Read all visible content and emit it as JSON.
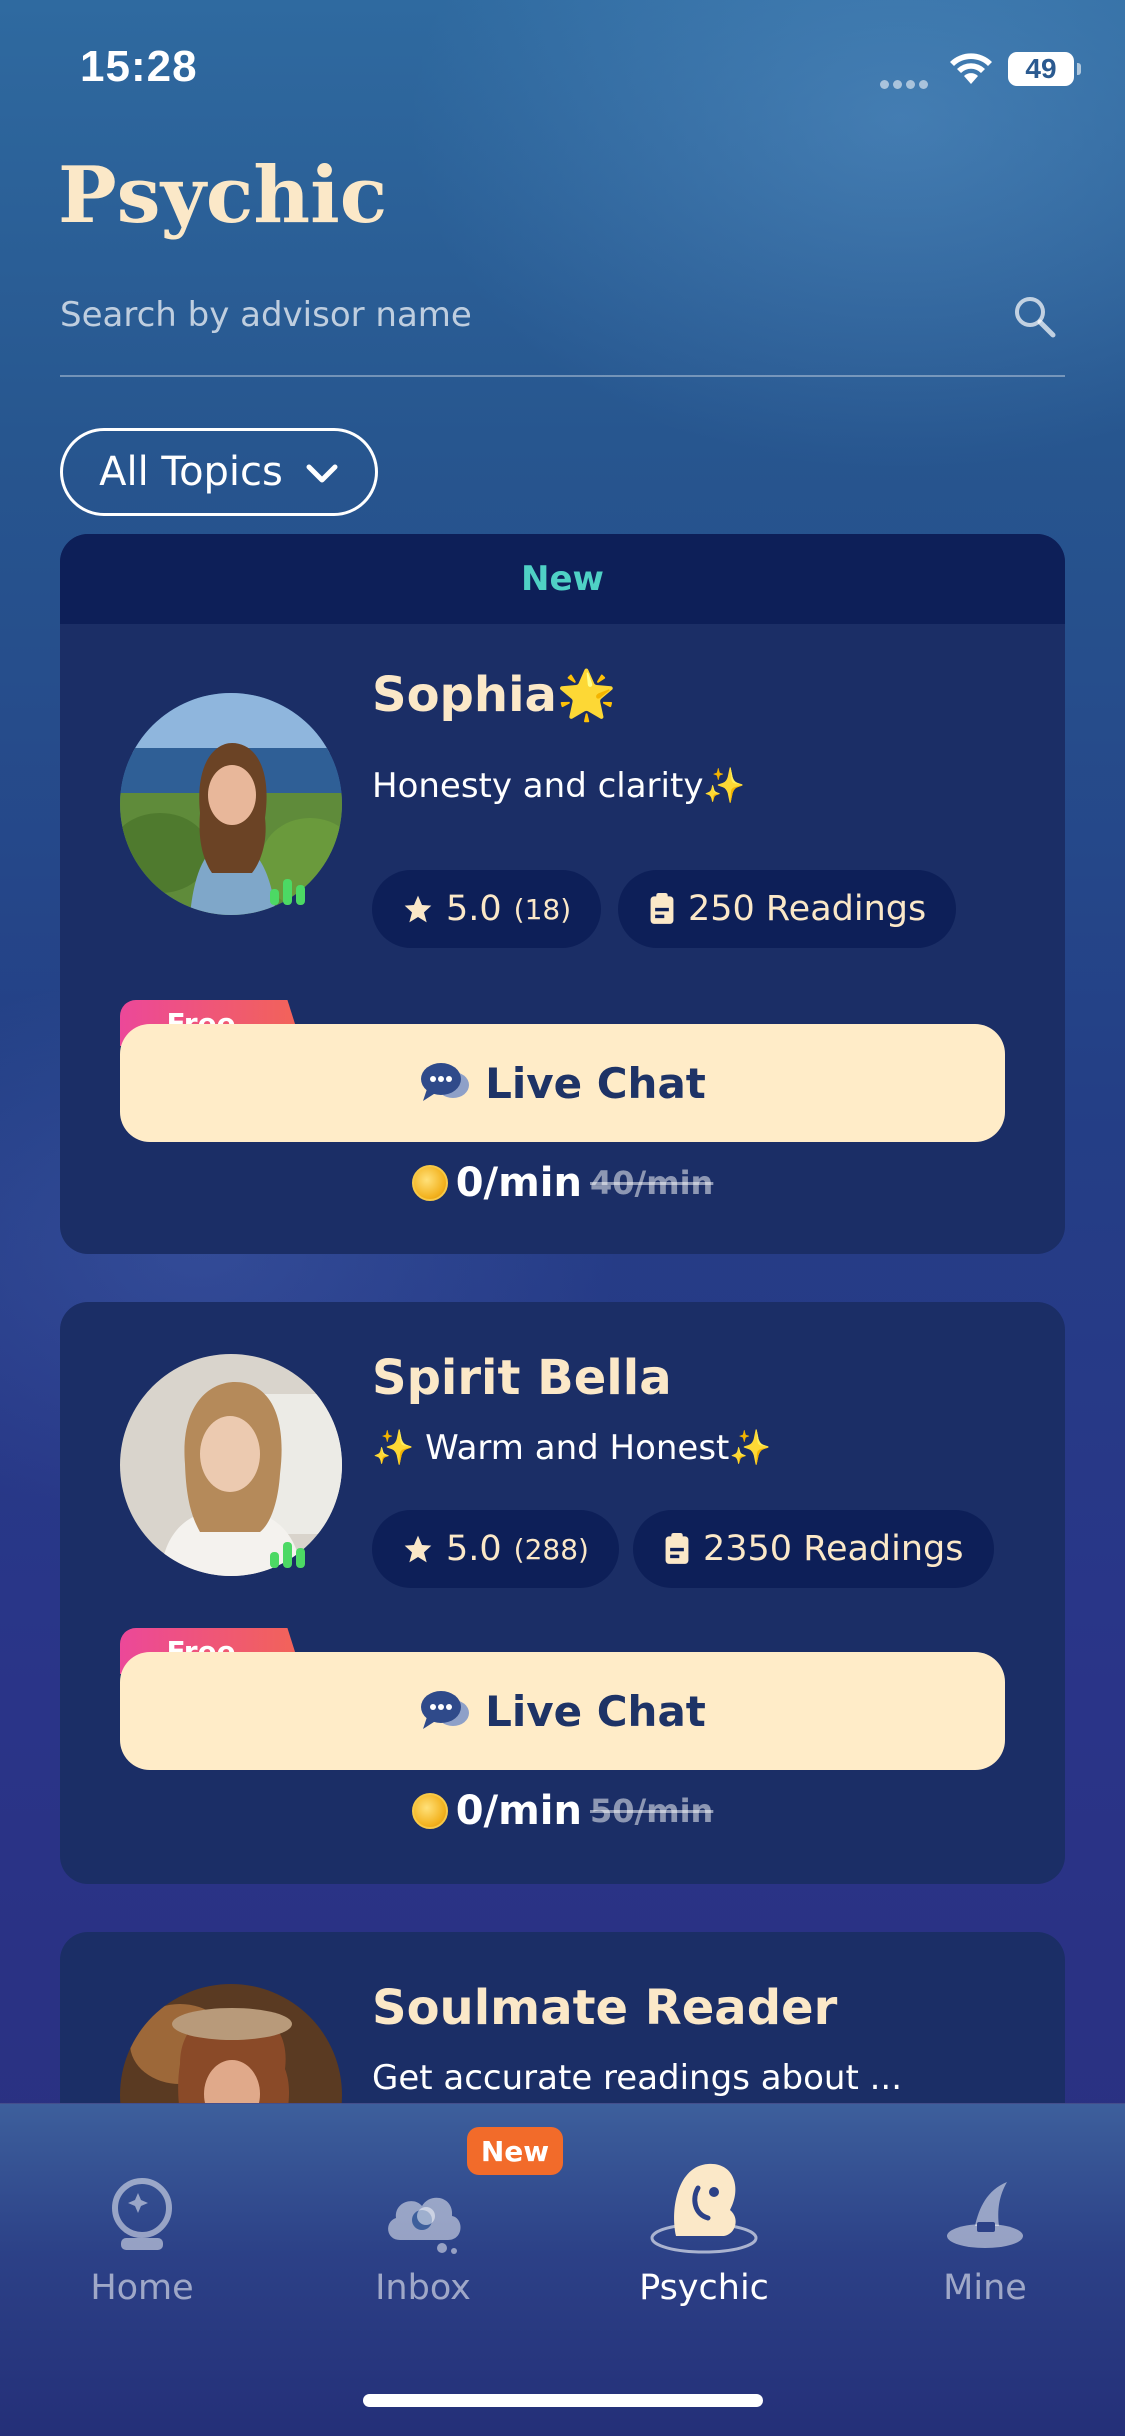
{
  "status_bar": {
    "time": "15:28",
    "battery": "49"
  },
  "page": {
    "title": "Psychic"
  },
  "search": {
    "placeholder": "Search by advisor name"
  },
  "filter": {
    "label": "All Topics"
  },
  "advisors": [
    {
      "banner": "New",
      "name": "Sophia🌟",
      "tagline": "Honesty and clarity✨",
      "rating": "5.0",
      "rating_count": "(18)",
      "readings": "250 Readings",
      "free_tag": "Free",
      "chat_label": "Live Chat",
      "price_now": "0/min",
      "price_old": "40/min"
    },
    {
      "name": "Spirit Bella",
      "tagline": "✨ Warm and Honest✨",
      "rating": "5.0",
      "rating_count": "(288)",
      "readings": "2350 Readings",
      "free_tag": "Free",
      "chat_label": "Live Chat",
      "price_now": "0/min",
      "price_old": "50/min"
    },
    {
      "name": "Soulmate Reader",
      "tagline": "Get accurate readings about ..."
    }
  ],
  "tab_bar": {
    "items": [
      {
        "label": "Home",
        "icon": "crystal-ball-icon"
      },
      {
        "label": "Inbox",
        "icon": "cloud-moon-icon",
        "badge": "New"
      },
      {
        "label": "Psychic",
        "icon": "psychic-icon",
        "active": true
      },
      {
        "label": "Mine",
        "icon": "witch-hat-icon"
      }
    ]
  },
  "colors": {
    "accent_cream": "#fbe8c8",
    "card_bg": "#1b2e66",
    "banner_teal": "#4fd1c5",
    "online_green": "#4cd964",
    "badge_orange": "#f26b2a"
  }
}
